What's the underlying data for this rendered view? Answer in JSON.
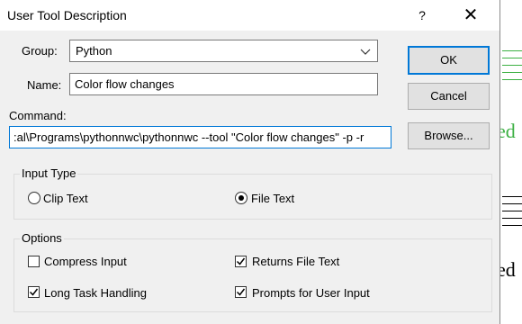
{
  "window": {
    "title": "User Tool Description",
    "help_glyph": "?",
    "close_glyph": "✕"
  },
  "fields": {
    "group_label": "Group:",
    "group_value": "Python",
    "name_label": "Name:",
    "name_value": "Color flow changes",
    "command_label": "Command:",
    "command_value": ":al\\Programs\\pythonnwc\\pythonnwc --tool \"Color flow changes\" -p -r"
  },
  "buttons": {
    "ok": "OK",
    "cancel": "Cancel",
    "browse": "Browse..."
  },
  "input_type": {
    "legend": "Input Type",
    "options": [
      {
        "label": "Clip Text",
        "selected": false
      },
      {
        "label": "File Text",
        "selected": true
      }
    ]
  },
  "options": {
    "legend": "Options",
    "items": [
      {
        "label": "Compress Input",
        "checked": false
      },
      {
        "label": "Returns File Text",
        "checked": true
      },
      {
        "label": "Long Task Handling",
        "checked": true
      },
      {
        "label": "Prompts for User Input",
        "checked": true
      }
    ]
  },
  "colors": {
    "accent": "#0078d7",
    "background_green": "#3cb043"
  },
  "background": {
    "fragment_1": "ed",
    "fragment_2": "ed"
  }
}
